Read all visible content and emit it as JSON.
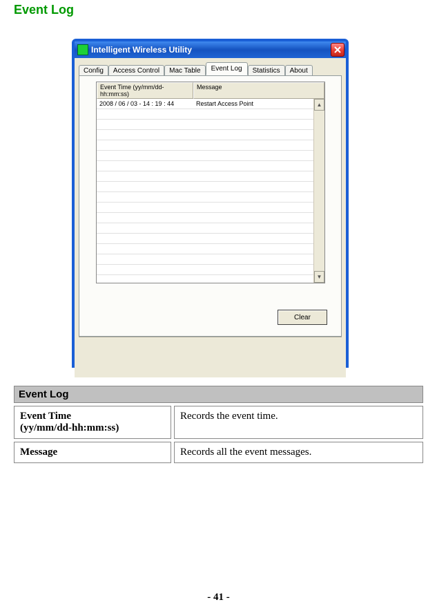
{
  "page": {
    "title": "Event Log",
    "page_number": "- 41 -"
  },
  "dialog": {
    "window_title": "Intelligent Wireless Utility",
    "tabs": [
      {
        "label": "Config"
      },
      {
        "label": "Access Control"
      },
      {
        "label": "Mac Table"
      },
      {
        "label": "Event Log",
        "active": true
      },
      {
        "label": "Statistics"
      },
      {
        "label": "About"
      }
    ],
    "columns": {
      "time": "Event Time (yy/mm/dd- hh:mm:ss)",
      "message": "Message"
    },
    "rows": [
      {
        "time": "2008 / 06 / 03 - 14 : 19 : 44",
        "message": "Restart Access Point"
      }
    ],
    "clear_button": "Clear"
  },
  "desc": {
    "header": "Event Log",
    "rows": [
      {
        "label_line1": "Event Time",
        "label_line2": "(yy/mm/dd-hh:mm:ss)",
        "value": "Records the event time."
      },
      {
        "label_line1": "Message",
        "label_line2": "",
        "value": "Records all the event messages."
      }
    ]
  }
}
